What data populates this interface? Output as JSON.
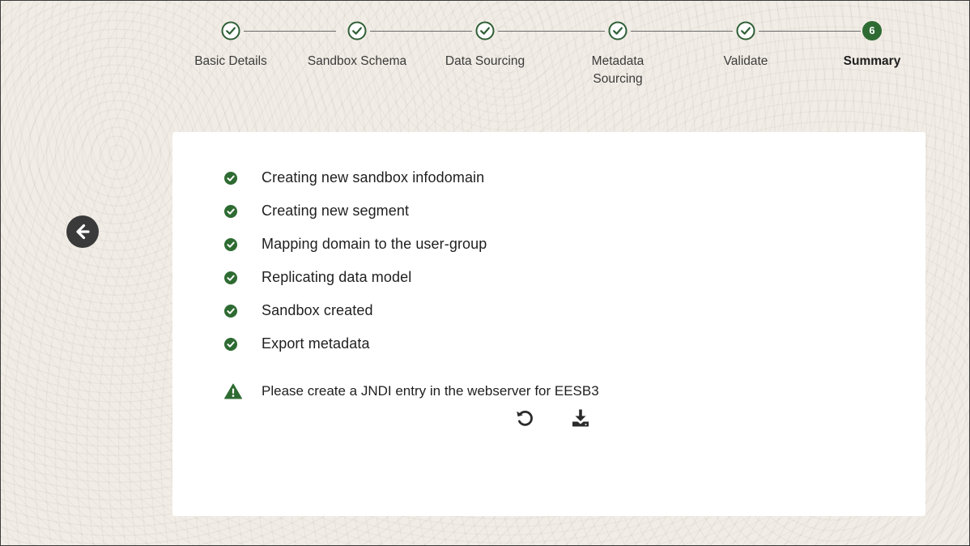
{
  "stepper": {
    "steps": [
      {
        "label": "Basic Details",
        "state": "completed"
      },
      {
        "label": "Sandbox Schema",
        "state": "completed"
      },
      {
        "label": "Data Sourcing",
        "state": "completed"
      },
      {
        "label": "Metadata Sourcing",
        "state": "completed"
      },
      {
        "label": "Validate",
        "state": "completed"
      },
      {
        "label": "Summary",
        "state": "current",
        "number": "6"
      }
    ]
  },
  "back_button": {
    "icon": "arrow-left-icon"
  },
  "summary": {
    "status_items": [
      {
        "text": "Creating new sandbox infodomain",
        "icon": "check-circle-icon"
      },
      {
        "text": "Creating new segment",
        "icon": "check-circle-icon"
      },
      {
        "text": "Mapping domain to the user-group",
        "icon": "check-circle-icon"
      },
      {
        "text": "Replicating data model",
        "icon": "check-circle-icon"
      },
      {
        "text": "Sandbox created",
        "icon": "check-circle-icon"
      },
      {
        "text": "Export metadata",
        "icon": "check-circle-icon"
      }
    ],
    "warning": {
      "text": "Please create a JNDI entry in the webserver for EESB3",
      "icon": "warning-triangle-icon"
    },
    "actions": {
      "refresh_icon": "refresh-icon",
      "download_icon": "download-icon"
    }
  },
  "colors": {
    "success": "#2e6b32",
    "step_check": "#2f5f36",
    "dark_icon": "#2b2b2b",
    "background": "#f1ede6",
    "card": "#ffffff"
  }
}
